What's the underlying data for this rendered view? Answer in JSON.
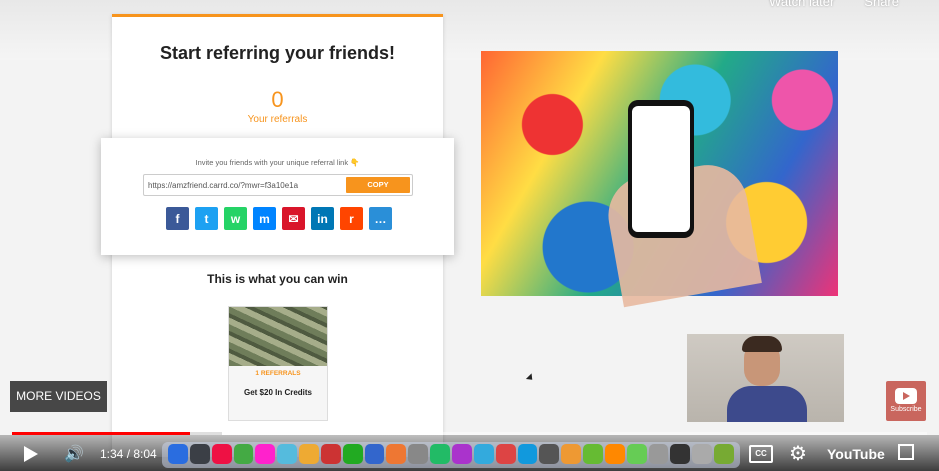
{
  "top_actions": {
    "watch_later": "Watch later",
    "share": "Share"
  },
  "referral": {
    "title": "Start referring your friends!",
    "count": "0",
    "count_label": "Your referrals",
    "invite_text": "Invite you friends with your unique referral link 👇",
    "link": "https://amzfriend.carrd.co/?mwr=f3a10e1a",
    "copy_label": "COPY",
    "share_icons": [
      {
        "name": "facebook-icon",
        "glyph": "f",
        "color": "#3b5998"
      },
      {
        "name": "twitter-icon",
        "glyph": "t",
        "color": "#1da1f2"
      },
      {
        "name": "whatsapp-icon",
        "glyph": "w",
        "color": "#25d366"
      },
      {
        "name": "messenger-icon",
        "glyph": "m",
        "color": "#0084ff"
      },
      {
        "name": "email-icon",
        "glyph": "✉",
        "color": "#d9152a"
      },
      {
        "name": "linkedin-icon",
        "glyph": "in",
        "color": "#0077b5"
      },
      {
        "name": "reddit-icon",
        "glyph": "r",
        "color": "#ff4500"
      },
      {
        "name": "sms-icon",
        "glyph": "…",
        "color": "#2a8fd8"
      }
    ],
    "win_title": "This is what you can win",
    "prize_refs": "1 REFERRALS",
    "prize_name": "Get $20 In Credits"
  },
  "player": {
    "more_videos": "MORE VIDEOS",
    "subscribe": "Subscribe",
    "time": "1:34 / 8:04",
    "progress_played": 0.194,
    "progress_buffered": 0.23,
    "cc": "CC",
    "youtube": "YouTube"
  },
  "dock_apps": [
    "#2a6de0",
    "#3b3f46",
    "#e14",
    "#4a4",
    "#f2c",
    "#5bd",
    "#ea3",
    "#c33",
    "#2a2",
    "#36c",
    "#e73",
    "#888",
    "#2b6",
    "#a3c",
    "#3ad",
    "#d44",
    "#19d",
    "#555",
    "#e93",
    "#6b3",
    "#f80",
    "#6c5",
    "#999",
    "#333",
    "#aaa",
    "#7a3"
  ]
}
